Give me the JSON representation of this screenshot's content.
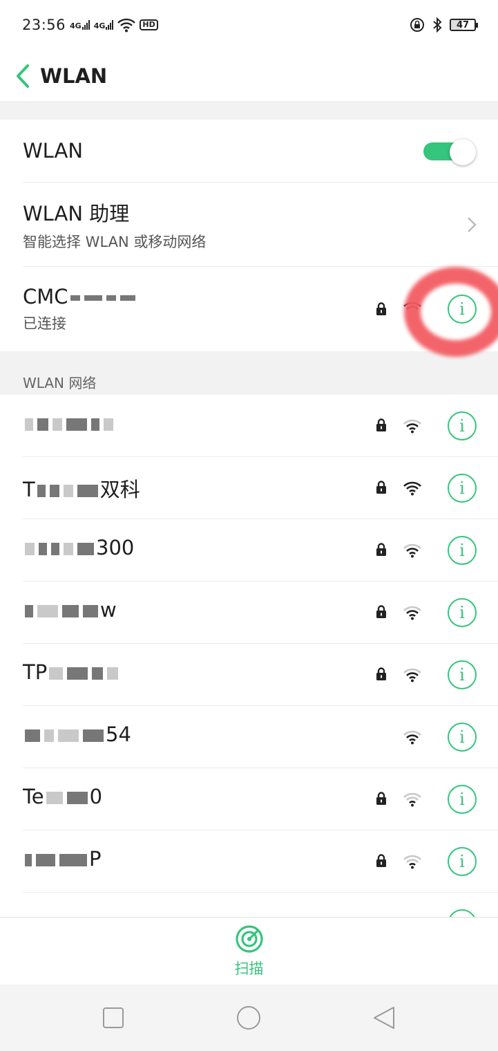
{
  "status_bar": {
    "time": "23:56",
    "signal1": "4G",
    "signal2": "4G",
    "hd_label": "HD",
    "battery": "47",
    "battery_level_percent": 47
  },
  "header": {
    "title": "WLAN"
  },
  "settings": {
    "wlan_toggle_label": "WLAN",
    "wlan_enabled": true,
    "assistant_title": "WLAN 助理",
    "assistant_subtitle": "智能选择 WLAN 或移动网络",
    "connected_name": "CMC",
    "connected_status": "已连接"
  },
  "section": {
    "label": "WLAN 网络"
  },
  "networks": [
    {
      "name_prefix": "",
      "name_suffix": "",
      "locked": true,
      "strength": "medium"
    },
    {
      "name_prefix": "T",
      "name_suffix": "双科",
      "locked": true,
      "strength": "strong"
    },
    {
      "name_prefix": "",
      "name_suffix": "300",
      "locked": true,
      "strength": "medium"
    },
    {
      "name_prefix": "",
      "name_suffix": "w",
      "locked": true,
      "strength": "medium"
    },
    {
      "name_prefix": "TP",
      "name_suffix": "",
      "locked": true,
      "strength": "medium"
    },
    {
      "name_prefix": "",
      "name_suffix": "54",
      "locked": false,
      "strength": "medium"
    },
    {
      "name_prefix": "Te",
      "name_suffix": "0",
      "locked": true,
      "strength": "weak"
    },
    {
      "name_prefix": "",
      "name_suffix": "P",
      "locked": true,
      "strength": "weak"
    }
  ],
  "bottom": {
    "scan_label": "扫描"
  },
  "colors": {
    "accent": "#35c57c",
    "highlight_ring": "#f25c62"
  },
  "icons": [
    "back-arrow-icon",
    "chevron-right-icon",
    "lock-icon",
    "wifi-icon",
    "info-icon",
    "scan-icon",
    "recent-apps-icon",
    "home-icon",
    "back-icon"
  ]
}
